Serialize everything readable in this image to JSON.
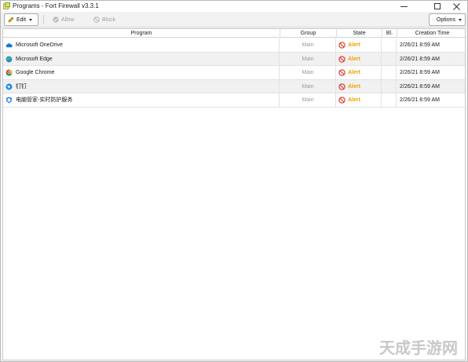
{
  "window": {
    "title": "Programs - Fort Firewall v3.3.1",
    "controls": {
      "minimize": "–",
      "maximize": "☐",
      "close": "✕"
    }
  },
  "toolbar": {
    "edit_label": "Edit",
    "allow_label": "Allow",
    "block_label": "Block",
    "options_label": "Options"
  },
  "table": {
    "columns": [
      "Program",
      "Group",
      "State",
      "Bl.",
      "Creation Time"
    ],
    "rows": [
      {
        "icon": "onedrive-icon",
        "program": "Microsoft OneDrive",
        "group": "Main",
        "state": "Alert",
        "bl": "",
        "creation_time": "2/26/21 8:59 AM"
      },
      {
        "icon": "edge-icon",
        "program": "Microsoft Edge",
        "group": "Main",
        "state": "Alert",
        "bl": "",
        "creation_time": "2/26/21 8:59 AM"
      },
      {
        "icon": "chrome-icon",
        "program": "Google Chrome",
        "group": "Main",
        "state": "Alert",
        "bl": "",
        "creation_time": "2/26/21 8:59 AM"
      },
      {
        "icon": "dingtalk-icon",
        "program": "钉钉",
        "group": "Main",
        "state": "Alert",
        "bl": "",
        "creation_time": "2/26/21 8:59 AM"
      },
      {
        "icon": "tencent-pc-manager-icon",
        "program": "电脑管家-实时防护服务",
        "group": "Main",
        "state": "Alert",
        "bl": "",
        "creation_time": "2/26/21 8:59 AM"
      }
    ]
  },
  "watermark": "天成手游网",
  "colors": {
    "alert": "#f0a000",
    "block_red": "#e03a2f"
  }
}
